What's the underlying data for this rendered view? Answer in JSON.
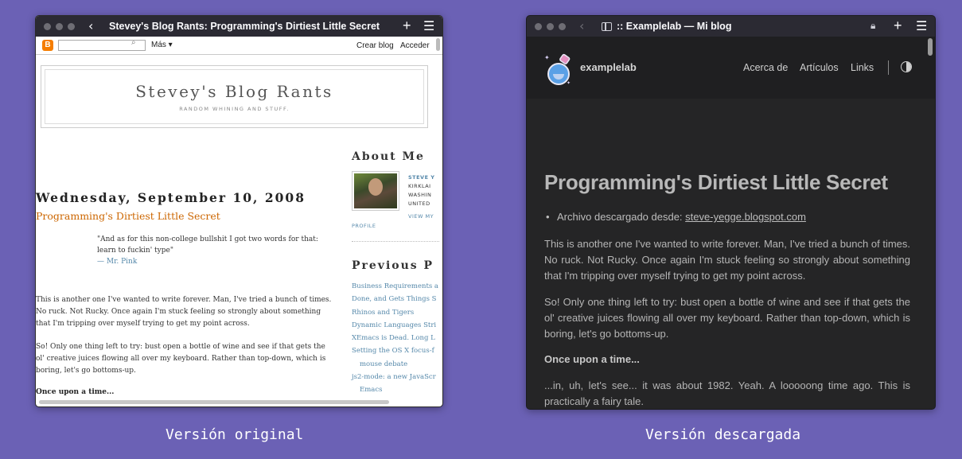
{
  "left_window": {
    "title": "Stevey's Blog Rants: Programming's Dirtiest Little Secret",
    "blogger_bar": {
      "logo": "B",
      "search_icon": "⌕",
      "more": "Más ▾",
      "create": "Crear blog",
      "login": "Acceder"
    },
    "blog": {
      "title": "Stevey's Blog Rants",
      "description": "RANDOM WHINING AND STUFF.",
      "date": "Wednesday, September 10, 2008",
      "post_title": "Programming's Dirtiest Little Secret",
      "quote": "\"And as for this non-college bullshit I got two words for that: learn to fuckin' type\"",
      "quote_attr": "— Mr. Pink",
      "paragraph1": "This is another one I've wanted to write forever. Man, I've tried a bunch of times. No ruck. Not Rucky. Once again I'm stuck feeling so strongly about something that I'm tripping over myself trying to get my point across.",
      "paragraph2": "So! Only one thing left to try: bust open a bottle of wine and see if that gets the ol' creative juices flowing all over my keyboard. Rather than top-down, which is boring, let's go bottoms-up.",
      "once": "Once upon a time..."
    },
    "sidebar": {
      "about_heading": "About Me",
      "profile_lines": [
        "STEVE Y",
        "KIRKLAI",
        "WASHIN",
        "UNITED"
      ],
      "view_my": "VIEW MY",
      "profile": "PROFILE",
      "previous_heading": "Previous P",
      "previous_posts": [
        "Business Requirements a",
        "Done, and Gets Things S",
        "Rhinos and Tigers",
        "Dynamic Languages Stri",
        "XEmacs is Dead. Long L",
        "Setting the OS X focus-f",
        "mouse debate",
        "js2-mode: a new JavaScr",
        "Emacs"
      ]
    }
  },
  "right_window": {
    "title": ":: Examplelab — Mi blog",
    "brand": "examplelab",
    "nav": [
      "Acerca de",
      "Artículos",
      "Links"
    ],
    "article": {
      "title": "Programming's Dirtiest Little Secret",
      "source_label": "Archivo descargado desde:",
      "source_link": "steve-yegge.blogspot.com",
      "paragraph1": "This is another one I've wanted to write forever. Man, I've tried a bunch of times. No ruck. Not Rucky. Once again I'm stuck feeling so strongly about something that I'm tripping over myself trying to get my point across.",
      "paragraph2": "So! Only one thing left to try: bust open a bottle of wine and see if that gets the ol' creative juices flowing all over my keyboard. Rather than top-down, which is boring, let's go bottoms-up.",
      "heading": "Once upon a time...",
      "paragraph3": "...in, uh, let's see... it was about 1982. Yeah. A looooong time ago. This is practically a fairy tale."
    }
  },
  "captions": {
    "left": "Versión original",
    "right": "Versión descargada"
  },
  "colors": {
    "background": "#6b61b5",
    "link_orange": "#cc6600",
    "link_blue": "#5588aa",
    "dark_bg": "#252526"
  }
}
